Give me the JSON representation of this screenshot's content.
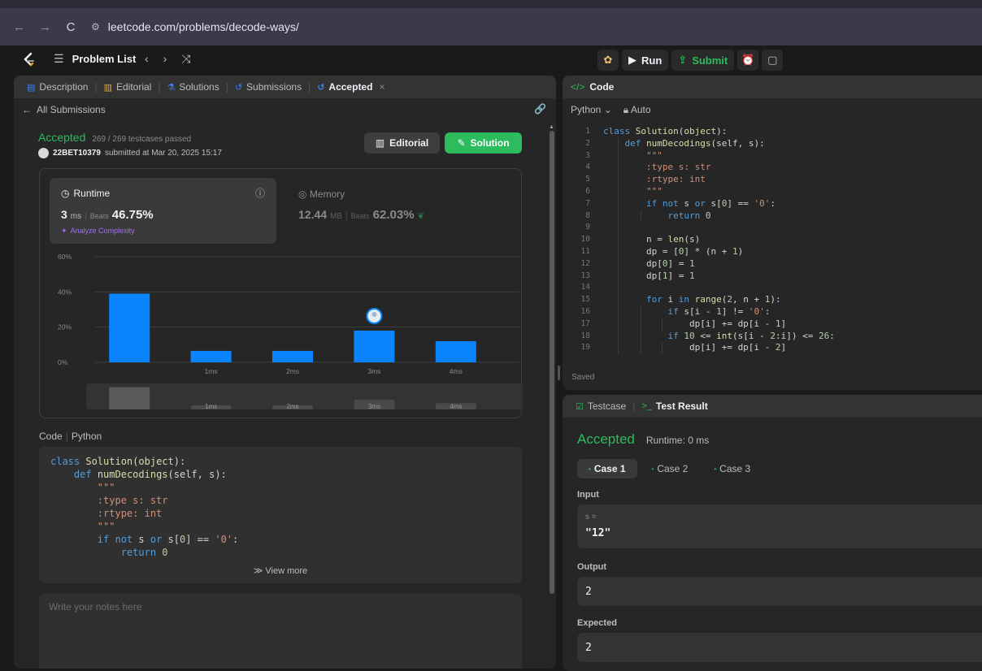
{
  "browser": {
    "url": "leetcode.com/problems/decode-ways/"
  },
  "nav": {
    "problem_list": "Problem List"
  },
  "toolbar": {
    "run": "Run",
    "submit": "Submit"
  },
  "left_tabs": [
    {
      "label": "Description"
    },
    {
      "label": "Editorial"
    },
    {
      "label": "Solutions"
    },
    {
      "label": "Submissions"
    },
    {
      "label": "Accepted"
    }
  ],
  "all_submissions": "All Submissions",
  "submission": {
    "status": "Accepted",
    "testcases": "269 / 269 testcases passed",
    "user": "22BET10379",
    "submitted_at": "submitted at Mar 20, 2025 15:17",
    "editorial_btn": "Editorial",
    "solution_btn": "Solution"
  },
  "runtime": {
    "label": "Runtime",
    "value": "3",
    "unit": "ms",
    "beats_label": "Beats",
    "beats": "46.75%",
    "analyze": "Analyze Complexity"
  },
  "memory": {
    "label": "Memory",
    "value": "12.44",
    "unit": "MB",
    "beats_label": "Beats",
    "beats": "62.03%"
  },
  "chart_data": {
    "type": "bar",
    "categories": [
      "",
      "1ms",
      "2ms",
      "3ms",
      "4ms"
    ],
    "values": [
      39,
      6.5,
      6.5,
      18,
      12
    ],
    "yticks": [
      "60%",
      "40%",
      "20%",
      "0%"
    ],
    "ylim": [
      0,
      60
    ],
    "highlight_index": 3,
    "bar_color": "#0a84ff",
    "mini_labels": [
      "",
      "1ms",
      "2ms",
      "3ms",
      "4ms"
    ]
  },
  "code_section": {
    "label": "Code",
    "lang": "Python",
    "view_more": "View more",
    "notes_placeholder": "Write your notes here",
    "preview": [
      "class Solution(object):",
      "    def numDecodings(self, s):",
      "        \"\"\"",
      "        :type s: str",
      "        :rtype: int",
      "        \"\"\"",
      "        if not s or s[0] == '0':",
      "            return 0"
    ]
  },
  "editor": {
    "title": "Code",
    "lang": "Python",
    "mode": "Auto",
    "saved": "Saved",
    "lines": [
      "class Solution(object):",
      "    def numDecodings(self, s):",
      "        \"\"\"",
      "        :type s: str",
      "        :rtype: int",
      "        \"\"\"",
      "        if not s or s[0] == '0':",
      "            return 0",
      "",
      "        n = len(s)",
      "        dp = [0] * (n + 1)",
      "        dp[0] = 1",
      "        dp[1] = 1",
      "",
      "        for i in range(2, n + 1):",
      "            if s[i - 1] != '0':",
      "                dp[i] += dp[i - 1]",
      "            if 10 <= int(s[i - 2:i]) <= 26:",
      "                dp[i] += dp[i - 2]"
    ]
  },
  "test": {
    "testcase_tab": "Testcase",
    "result_tab": "Test Result",
    "status": "Accepted",
    "runtime": "Runtime: 0 ms",
    "cases": [
      "Case 1",
      "Case 2",
      "Case 3"
    ],
    "input_label": "Input",
    "input_var": "s =",
    "input_val": "\"12\"",
    "output_label": "Output",
    "output_val": "2",
    "expected_label": "Expected",
    "expected_val": "2"
  }
}
